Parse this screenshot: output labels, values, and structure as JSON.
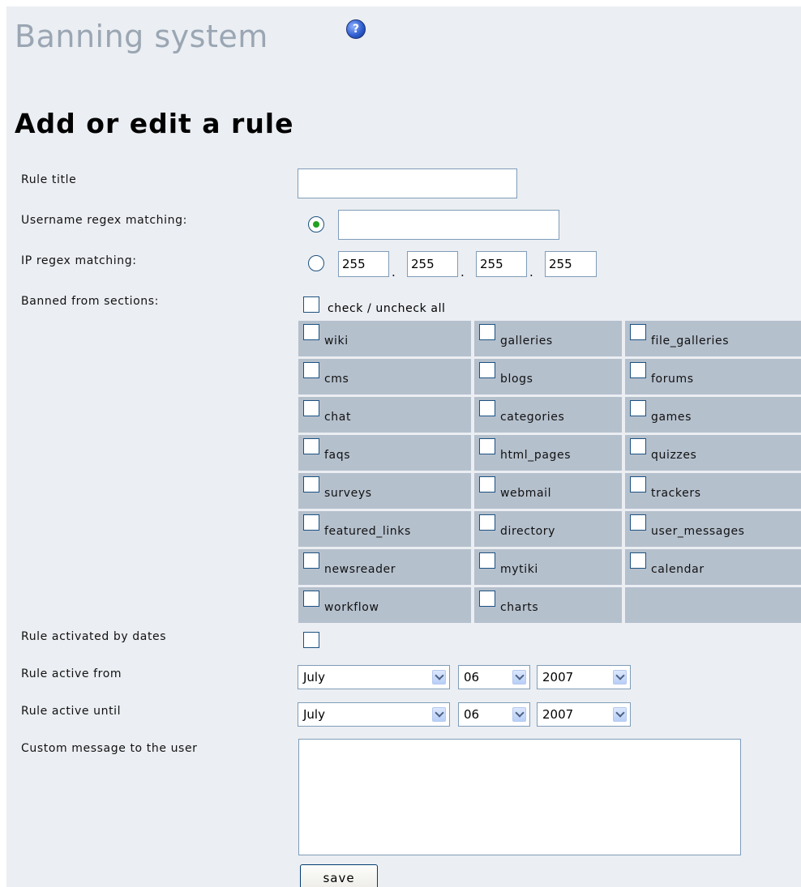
{
  "header": {
    "title": "Banning system",
    "help_icon": "help-icon"
  },
  "form": {
    "heading": "Add or edit a rule",
    "rule_title": {
      "label": "Rule title",
      "value": ""
    },
    "username_regex": {
      "label": "Username regex matching:",
      "value": "",
      "selected": true
    },
    "ip_regex": {
      "label": "IP regex matching:",
      "selected": false,
      "octets": [
        "255",
        "255",
        "255",
        "255"
      ]
    },
    "banned_sections": {
      "label": "Banned from sections:",
      "check_all_label": "check / uncheck all",
      "sections": [
        "wiki",
        "galleries",
        "file_galleries",
        "cms",
        "blogs",
        "forums",
        "chat",
        "categories",
        "games",
        "faqs",
        "html_pages",
        "quizzes",
        "surveys",
        "webmail",
        "trackers",
        "featured_links",
        "directory",
        "user_messages",
        "newsreader",
        "mytiki",
        "calendar",
        "workflow",
        "charts"
      ]
    },
    "activated_by_dates": {
      "label": "Rule activated by dates",
      "checked": false
    },
    "active_from": {
      "label": "Rule active from",
      "month": "July",
      "day": "06",
      "year": "2007"
    },
    "active_until": {
      "label": "Rule active until",
      "month": "July",
      "day": "06",
      "year": "2007"
    },
    "custom_message": {
      "label": "Custom message to the user",
      "value": ""
    },
    "save_label": "save"
  },
  "colors": {
    "page_bg": "#ebeef2",
    "title_gray": "#9aa6b3",
    "cell_bg": "#b5c0cd",
    "input_border": "#7f9db9"
  }
}
